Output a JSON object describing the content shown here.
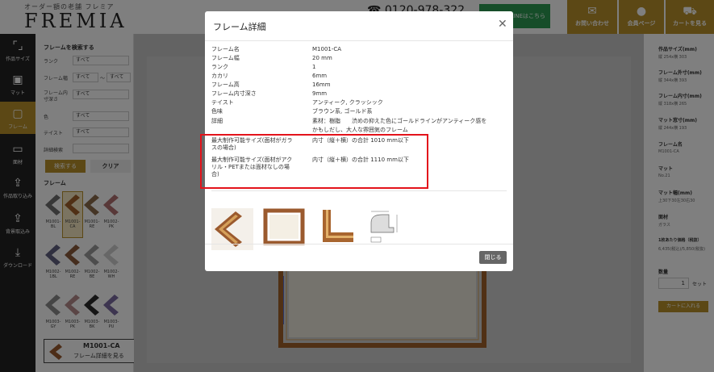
{
  "header": {
    "tagline": "オーダー額の老舗 フレミア",
    "logo": "FREMIA",
    "phone": "0120-978-322",
    "line_button": "LINEはこちら",
    "nav": [
      {
        "label": "お問い合わせ",
        "icon": "envelope-icon"
      },
      {
        "label": "会員ページ",
        "icon": "user-icon"
      },
      {
        "label": "カートを見る",
        "icon": "cart-icon"
      }
    ]
  },
  "iconbar": [
    {
      "label": "作品サイズ",
      "icon": "size-icon"
    },
    {
      "label": "マット",
      "icon": "mat-icon"
    },
    {
      "label": "フレーム",
      "icon": "frame-icon"
    },
    {
      "label": "面材",
      "icon": "glass-icon"
    },
    {
      "label": "作品取り込み",
      "icon": "import-icon"
    },
    {
      "label": "背景取込み",
      "icon": "background-icon"
    },
    {
      "label": "ダウンロード",
      "icon": "download-icon"
    }
  ],
  "filter": {
    "title": "フレームを検索する",
    "rank_label": "ランク",
    "rank_value": "すべて",
    "width_label": "フレーム幅",
    "width_from": "すべて",
    "width_sep": "〜",
    "width_to": "すべて",
    "depth_label": "フレーム内寸深さ",
    "depth_value": "すべて",
    "color_label": "色",
    "color_value": "すべて",
    "taste_label": "テイスト",
    "taste_value": "すべて",
    "detail_label": "詳細検索",
    "search_button": "検索する",
    "clear_button": "クリア",
    "frames_title": "フレーム",
    "frames": [
      "M1001-BL",
      "M1001-CA",
      "M1001-RE",
      "M1002-PK",
      "M1002-1BL",
      "M1002-RE",
      "M1002-BE",
      "M1002-WH",
      "M1003-GY",
      "M1003-PK",
      "M1003-BK",
      "M1003-PU"
    ],
    "selected_code": "M1001-CA",
    "selected_link": "フレーム詳細を見る"
  },
  "right_panel": {
    "items": [
      {
        "h": "作品サイズ(mm)",
        "v": "縦 254x横 303"
      },
      {
        "h": "フレーム外寸(mm)",
        "v": "縦 344x横 393"
      },
      {
        "h": "フレーム内寸(mm)",
        "v": "縦 318x横 265"
      },
      {
        "h": "マット窓寸(mm)",
        "v": "縦 244x横 193"
      },
      {
        "h": "フレーム名",
        "v": "M1001-CA"
      },
      {
        "h": "マット",
        "v": "No.21"
      },
      {
        "h": "マット幅(mm)",
        "v": "上30下30左30右30"
      },
      {
        "h": "面材",
        "v": "ガラス"
      },
      {
        "h": "1枚あたり価格（税抜）",
        "v": "6,435(税込)/5,850(税抜)"
      }
    ],
    "qty_label": "数量",
    "qty_value": "1",
    "qty_unit": "セット",
    "cart_button": "カートに入れる"
  },
  "modal": {
    "title": "フレーム詳細",
    "rows": [
      {
        "label": "フレーム名",
        "value": "M1001-CA"
      },
      {
        "label": "フレーム幅",
        "value": "20 mm"
      },
      {
        "label": "ランク",
        "value": "1"
      },
      {
        "label": "カカリ",
        "value": "6mm"
      },
      {
        "label": "フレーム高",
        "value": "16mm"
      },
      {
        "label": "フレーム内寸深さ",
        "value": "9mm"
      },
      {
        "label": "テイスト",
        "value": "アンティーク, クラッシック"
      },
      {
        "label": "色味",
        "value": "ブラウン系, ゴールド系"
      },
      {
        "label": "詳細",
        "value": "素材：樹脂　　渋めの抑えた色にゴールドラインがアンティーク感を"
      }
    ],
    "detail_line2": "かもしだし、大人な雰囲気のフレーム",
    "max_glass_label_1": "最大制作可能サイズ(面材がガラ",
    "max_glass_label_2": "スの場合)",
    "max_glass_value": "内寸（縦＋横）の合計 1010 mm以下",
    "max_acryl_label_1": "最大制作可能サイズ(面材がアク",
    "max_acryl_label_2": "リル・PETまたは面材なしの場",
    "max_acryl_label_3": "合)",
    "max_acryl_value": "内寸（縦＋横）の合計 1110 mm以下",
    "close_button": "閉じる"
  }
}
